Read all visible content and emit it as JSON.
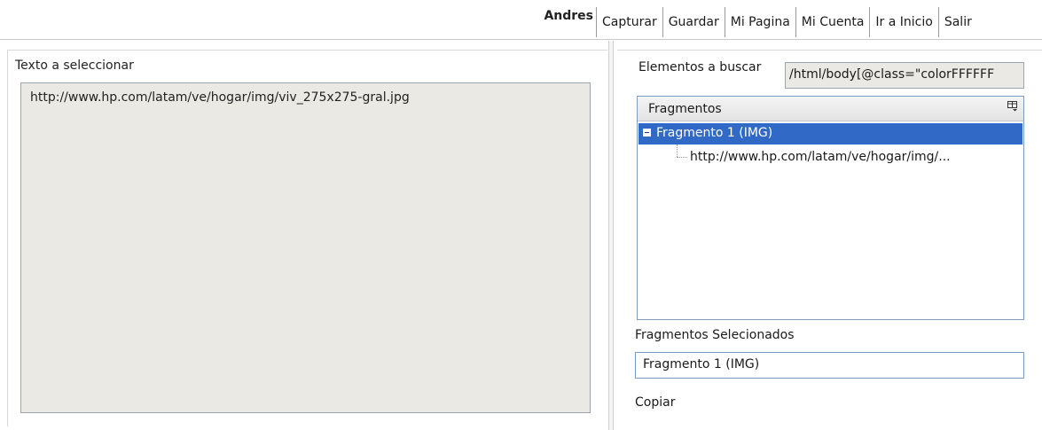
{
  "header": {
    "username": "Andres",
    "nav": [
      {
        "label": "Capturar"
      },
      {
        "label": "Guardar"
      },
      {
        "label": "Mi Pagina"
      },
      {
        "label": "Mi Cuenta"
      },
      {
        "label": "Ir a Inicio"
      },
      {
        "label": "Salir"
      }
    ]
  },
  "left": {
    "title": "Texto a seleccionar",
    "content": "http://www.hp.com/latam/ve/hogar/img/viv_275x275-gral.jpg"
  },
  "right": {
    "search_label": "Elementos a buscar",
    "xpath_value": "/html/body[@class=\"colorFFFFFF",
    "tree": {
      "header": "Fragmentos",
      "column_chooser_icon": "column-chooser-icon",
      "items": [
        {
          "label": "Fragmento 1 (IMG)",
          "expanded": true,
          "selected": true,
          "children": [
            {
              "label": "http://www.hp.com/latam/ve/hogar/img/..."
            }
          ]
        }
      ]
    },
    "selected_label": "Fragmentos Selecionados",
    "selected_value": "Fragmento 1 (IMG)",
    "copy_label": "Copiar"
  },
  "colors": {
    "selection": "#3169c6",
    "readonly_background": "#ebe9e3"
  }
}
